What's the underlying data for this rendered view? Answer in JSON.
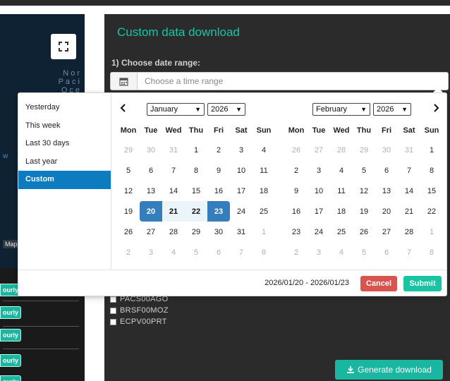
{
  "map": {
    "ocean_label_lines": [
      "Nor",
      "Paci",
      "Oce"
    ],
    "west_label": "w",
    "attribution": "Map",
    "hourly_badge_label": "ourly",
    "fullscreen_icon": "fullscreen-icon"
  },
  "panel": {
    "title": "Custom data download",
    "step_label": "1) Choose date range:",
    "date_input_placeholder": "Choose a time range",
    "calendar_icon": "calendar-icon",
    "stations": [
      "PACS00AGO",
      "BRSF00MOZ",
      "ECPV00PRT"
    ],
    "generate_button": "Generate download"
  },
  "picker": {
    "ranges": [
      {
        "label": "Yesterday",
        "active": false
      },
      {
        "label": "This week",
        "active": false
      },
      {
        "label": "Last 30 days",
        "active": false
      },
      {
        "label": "Last year",
        "active": false
      },
      {
        "label": "Custom",
        "active": true
      }
    ],
    "weekday_headers": [
      "Mon",
      "Tue",
      "Wed",
      "Thu",
      "Fri",
      "Sat",
      "Sun"
    ],
    "left_calendar": {
      "month": "January",
      "year": "2026",
      "prev_label": "‹",
      "weeks": [
        [
          {
            "d": "29",
            "off": true
          },
          {
            "d": "30",
            "off": true
          },
          {
            "d": "31",
            "off": true
          },
          {
            "d": "1"
          },
          {
            "d": "2"
          },
          {
            "d": "3"
          },
          {
            "d": "4"
          }
        ],
        [
          {
            "d": "5"
          },
          {
            "d": "6"
          },
          {
            "d": "7"
          },
          {
            "d": "8"
          },
          {
            "d": "9"
          },
          {
            "d": "10"
          },
          {
            "d": "11"
          }
        ],
        [
          {
            "d": "12"
          },
          {
            "d": "13"
          },
          {
            "d": "14"
          },
          {
            "d": "15"
          },
          {
            "d": "16"
          },
          {
            "d": "17"
          },
          {
            "d": "18"
          }
        ],
        [
          {
            "d": "19"
          },
          {
            "d": "20",
            "state": "range-start"
          },
          {
            "d": "21",
            "state": "in-range"
          },
          {
            "d": "22",
            "state": "in-range"
          },
          {
            "d": "23",
            "state": "range-end"
          },
          {
            "d": "24"
          },
          {
            "d": "25"
          }
        ],
        [
          {
            "d": "26"
          },
          {
            "d": "27"
          },
          {
            "d": "28"
          },
          {
            "d": "29"
          },
          {
            "d": "30"
          },
          {
            "d": "31"
          },
          {
            "d": "1",
            "off": true
          }
        ],
        [
          {
            "d": "2",
            "off": true
          },
          {
            "d": "3",
            "off": true
          },
          {
            "d": "4",
            "off": true
          },
          {
            "d": "5",
            "off": true
          },
          {
            "d": "6",
            "off": true
          },
          {
            "d": "7",
            "off": true
          },
          {
            "d": "8",
            "off": true
          }
        ]
      ]
    },
    "right_calendar": {
      "month": "February",
      "year": "2026",
      "next_label": "›",
      "weeks": [
        [
          {
            "d": "26",
            "off": true
          },
          {
            "d": "27",
            "off": true
          },
          {
            "d": "28",
            "off": true
          },
          {
            "d": "29",
            "off": true
          },
          {
            "d": "30",
            "off": true
          },
          {
            "d": "31",
            "off": true
          },
          {
            "d": "1"
          }
        ],
        [
          {
            "d": "2"
          },
          {
            "d": "3"
          },
          {
            "d": "4"
          },
          {
            "d": "5"
          },
          {
            "d": "6"
          },
          {
            "d": "7"
          },
          {
            "d": "8"
          }
        ],
        [
          {
            "d": "9"
          },
          {
            "d": "10"
          },
          {
            "d": "11"
          },
          {
            "d": "12"
          },
          {
            "d": "13"
          },
          {
            "d": "14"
          },
          {
            "d": "15"
          }
        ],
        [
          {
            "d": "16"
          },
          {
            "d": "17"
          },
          {
            "d": "18"
          },
          {
            "d": "19"
          },
          {
            "d": "20"
          },
          {
            "d": "21"
          },
          {
            "d": "22"
          }
        ],
        [
          {
            "d": "23"
          },
          {
            "d": "24"
          },
          {
            "d": "25"
          },
          {
            "d": "26"
          },
          {
            "d": "27"
          },
          {
            "d": "28"
          },
          {
            "d": "1",
            "off": true
          }
        ],
        [
          {
            "d": "2",
            "off": true
          },
          {
            "d": "3",
            "off": true
          },
          {
            "d": "4",
            "off": true
          },
          {
            "d": "5",
            "off": true
          },
          {
            "d": "6",
            "off": true
          },
          {
            "d": "7",
            "off": true
          },
          {
            "d": "8",
            "off": true
          }
        ]
      ]
    },
    "selected_range": "2026/01/20 - 2026/01/23",
    "cancel_label": "Cancel",
    "submit_label": "Submit"
  },
  "colors": {
    "accent": "#19c4a5",
    "range_endpoint": "#357ebd",
    "active_range": "#0d7bc0",
    "cancel": "#d9534f"
  }
}
